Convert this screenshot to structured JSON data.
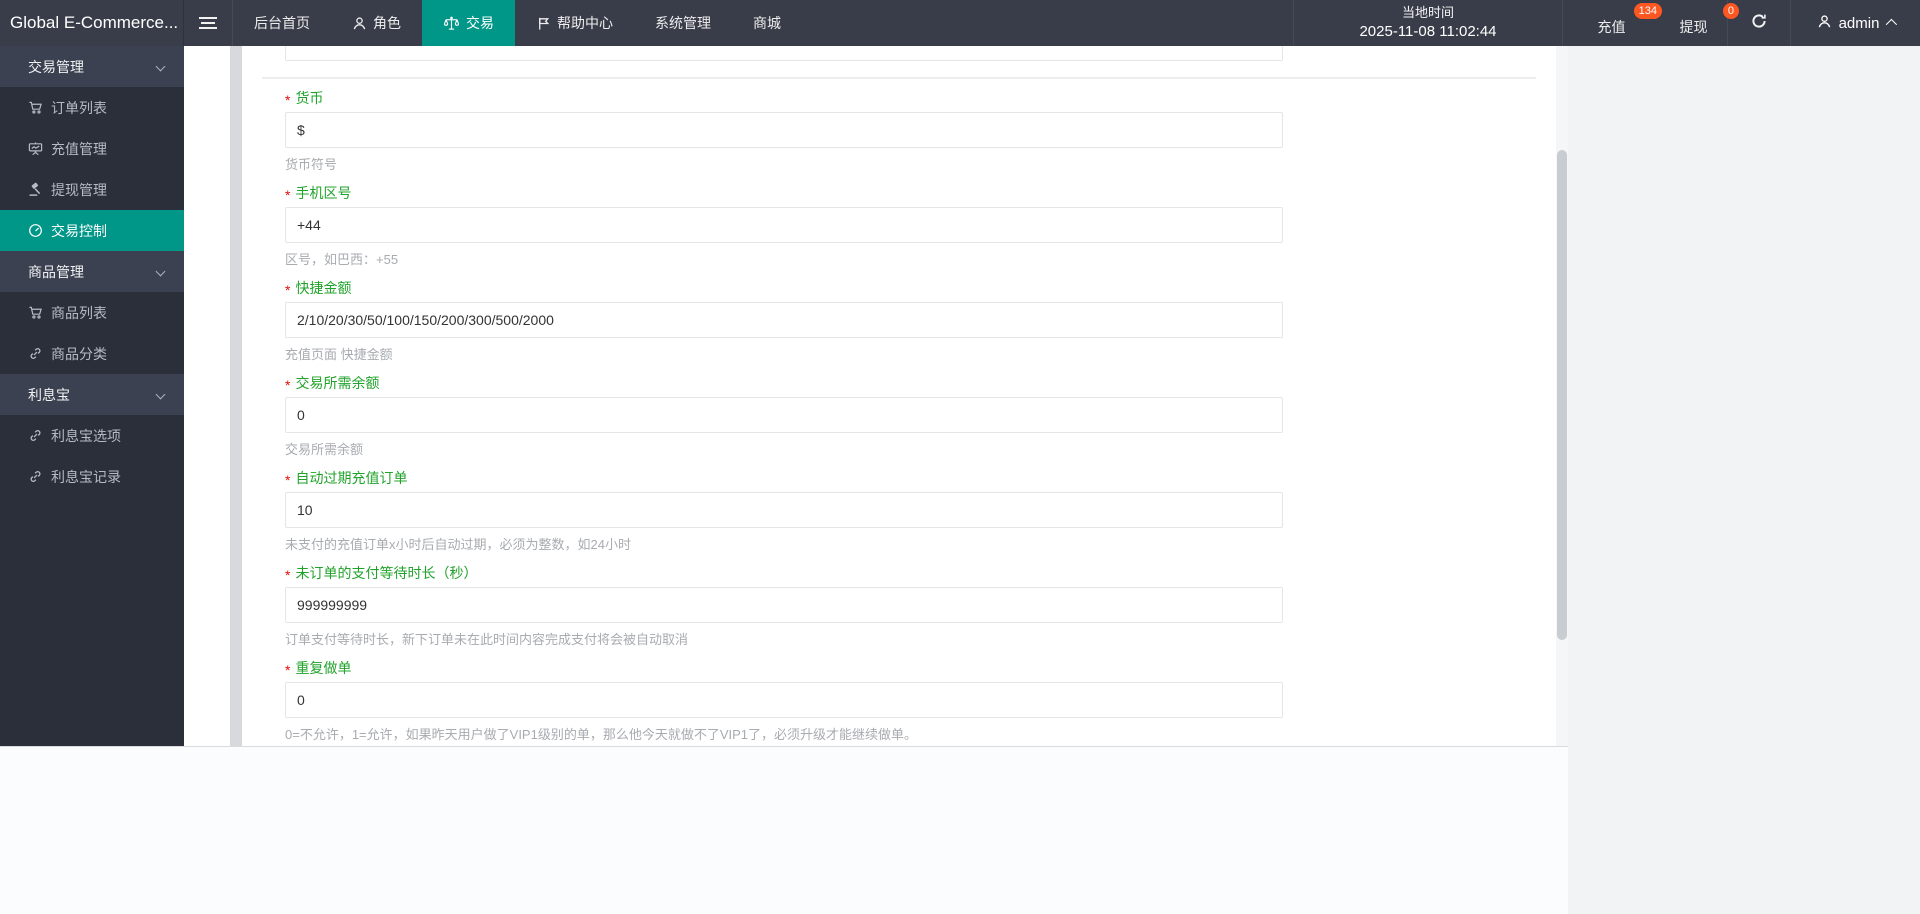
{
  "header": {
    "logo": "Global E-Commerce...",
    "nav": [
      {
        "label": "后台首页"
      },
      {
        "label": "角色",
        "icon": "user-icon"
      },
      {
        "label": "交易",
        "icon": "scales-icon",
        "active": true
      },
      {
        "label": "帮助中心",
        "icon": "flag-icon"
      },
      {
        "label": "系统管理"
      },
      {
        "label": "商城"
      }
    ],
    "local_time": {
      "label": "当地时间",
      "value": "2025-11-08 11:02:44"
    },
    "quick_actions": [
      {
        "label": "充值",
        "badge": "134"
      },
      {
        "label": "提现",
        "badge": "0"
      }
    ],
    "user": {
      "name": "admin"
    }
  },
  "sidebar": {
    "groups": [
      {
        "label": "交易管理",
        "expanded": true,
        "items": [
          {
            "label": "订单列表",
            "icon": "cart-icon"
          },
          {
            "label": "充值管理",
            "icon": "chart-board-icon"
          },
          {
            "label": "提现管理",
            "icon": "gavel-icon"
          },
          {
            "label": "交易控制",
            "icon": "gauge-icon",
            "active": true
          }
        ]
      },
      {
        "label": "商品管理",
        "expanded": true,
        "items": [
          {
            "label": "商品列表",
            "icon": "cart-icon"
          },
          {
            "label": "商品分类",
            "icon": "link-icon"
          }
        ]
      },
      {
        "label": "利息宝",
        "expanded": true,
        "items": [
          {
            "label": "利息宝选项",
            "icon": "link-icon"
          },
          {
            "label": "利息宝记录",
            "icon": "link-icon"
          }
        ]
      }
    ]
  },
  "form": {
    "fields": [
      {
        "label": "货币",
        "value": "$",
        "hint": "货币符号",
        "required": true
      },
      {
        "label": "手机区号",
        "value": "+44",
        "hint": "区号，如巴西：+55",
        "required": true
      },
      {
        "label": "快捷金额",
        "value": "2/10/20/30/50/100/150/200/300/500/2000",
        "hint": "充值页面 快捷金额",
        "required": true
      },
      {
        "label": "交易所需余额",
        "value": "0",
        "hint": "交易所需余额",
        "required": true
      },
      {
        "label": "自动过期充值订单",
        "value": "10",
        "hint": "未支付的充值订单x小时后自动过期，必须为整数，如24小时",
        "required": true
      },
      {
        "label": "未订单的支付等待时长（秒）",
        "value": "999999999",
        "hint": "订单支付等待时长，新下订单未在此时间内容完成支付将会被自动取消",
        "required": true
      },
      {
        "label": "重复做单",
        "value": "0",
        "hint": "0=不允许，1=允许，如果昨天用户做了VIP1级别的单，那么他今天就做不了VIP1了，必须升级才能继续做单。",
        "required": true
      }
    ]
  },
  "colors": {
    "accent": "#009688",
    "header_bg": "#393d49",
    "badge": "#ff5722",
    "label_green": "#21a32b",
    "asterisk_red": "#e80b0b"
  }
}
